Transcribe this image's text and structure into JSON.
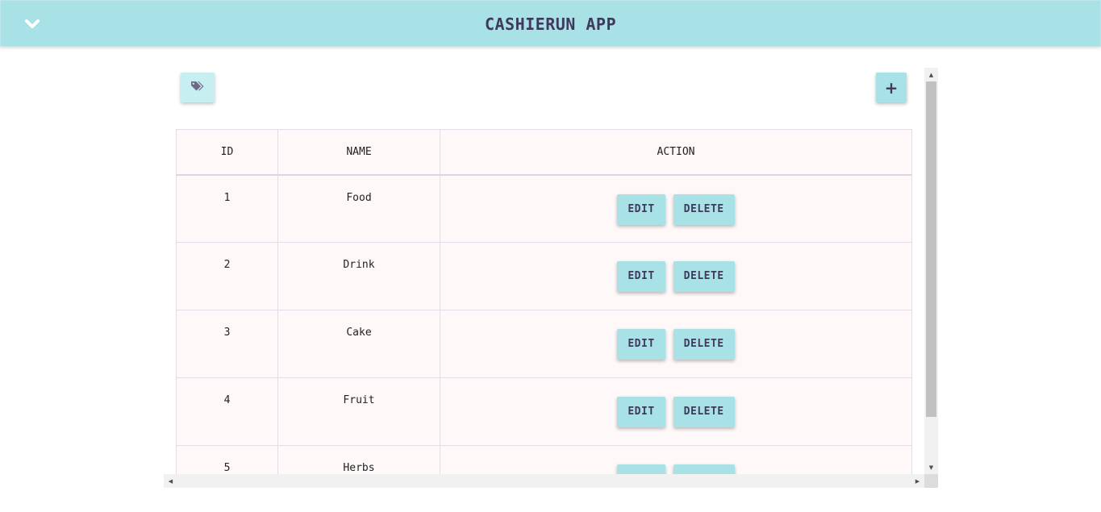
{
  "app": {
    "title": "CASHIERUN APP"
  },
  "toolbar": {
    "tag_icon": "tag-icon",
    "add_label": "+"
  },
  "table": {
    "columns": [
      "ID",
      "NAME",
      "ACTION"
    ],
    "rows": [
      {
        "id": "1",
        "name": "Food"
      },
      {
        "id": "2",
        "name": "Drink"
      },
      {
        "id": "3",
        "name": "Cake"
      },
      {
        "id": "4",
        "name": "Fruit"
      },
      {
        "id": "5",
        "name": "Herbs"
      }
    ],
    "edit_label": "EDIT",
    "delete_label": "DELETE"
  },
  "colors": {
    "accent": "#a8e2e7",
    "text_dark": "#3f3a5c",
    "row_bg": "#fff8f8"
  }
}
